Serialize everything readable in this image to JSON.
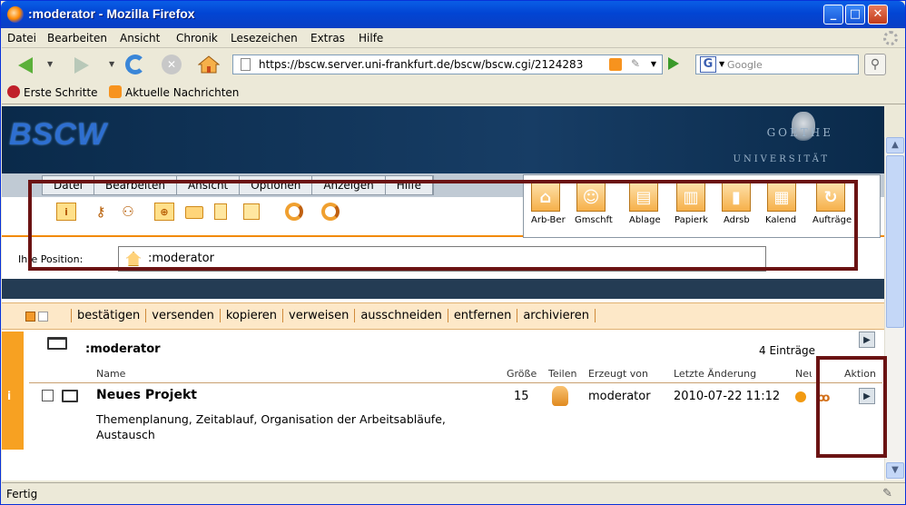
{
  "window": {
    "title": ":moderator - Mozilla Firefox"
  },
  "menubar": [
    "Datei",
    "Bearbeiten",
    "Ansicht",
    "Chronik",
    "Lesezeichen",
    "Extras",
    "Hilfe"
  ],
  "address": {
    "url": "https://bscw.server.uni-frankfurt.de/bscw/bscw.cgi/2124283"
  },
  "search": {
    "placeholder": "Google",
    "engine_glyph": "G"
  },
  "bookmarks": [
    "Erste Schritte",
    "Aktuelle Nachrichten"
  ],
  "bscw": {
    "logo": "BSCW",
    "uni_line1": "GOETHE",
    "uni_line2": "UNIVERSITÄT",
    "menu": [
      "Datei",
      "Bearbeiten",
      "Ansicht",
      "Optionen",
      "Anzeigen",
      "Hilfe"
    ],
    "nav_labels": [
      "Arb-Ber",
      "Gmschft",
      "Ablage",
      "Papierk",
      "Adrsb",
      "Kalend",
      "Aufträge"
    ],
    "position_label": "Ihre Position:",
    "position_value": ":moderator",
    "actions": [
      "bestätigen",
      "versenden",
      "kopieren",
      "verweisen",
      "ausschneiden",
      "entfernen",
      "archivieren"
    ],
    "folder": ":moderator",
    "entries": "4 Einträge",
    "columns": {
      "name": "Name",
      "size": "Größe",
      "share": "Teilen",
      "created_by": "Erzeugt von",
      "last_change": "Letzte Änderung",
      "new": "Neu",
      "action": "Aktion"
    },
    "row": {
      "info": "i",
      "title": "Neues Projekt",
      "size": "15",
      "created_by": "moderator",
      "last_change": "2010-07-22 11:12",
      "description": "Themenplanung, Zeitablauf, Organisation der Arbeitsabläufe, Austausch"
    }
  },
  "status": {
    "text": "Fertig"
  },
  "colors": {
    "accent": "#f7a122",
    "header_bg": "#173d65",
    "highlight_box": "#6b1313"
  }
}
